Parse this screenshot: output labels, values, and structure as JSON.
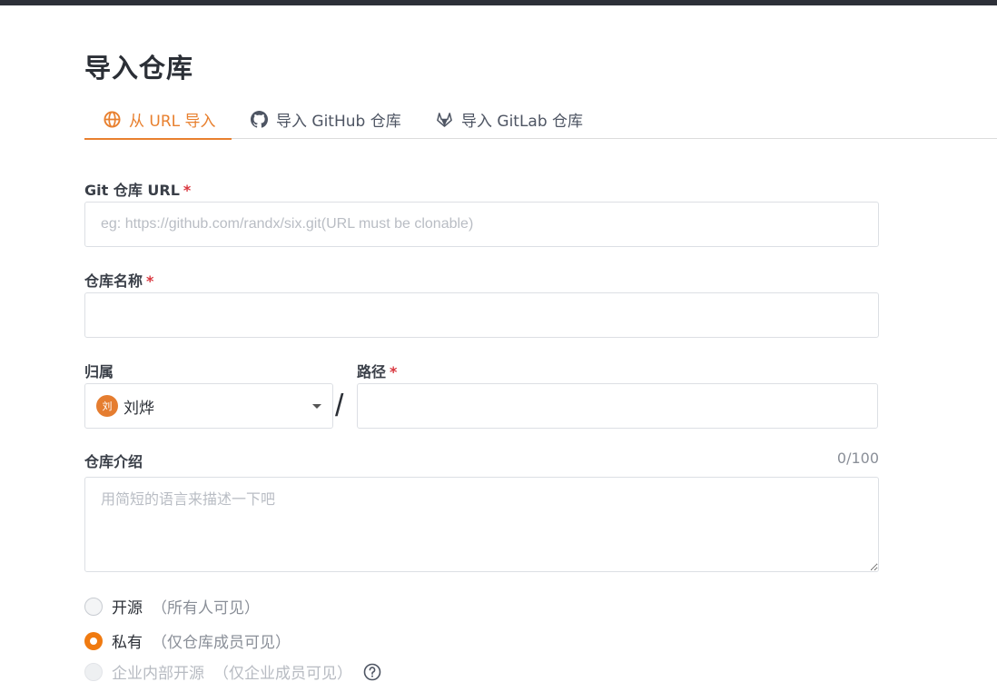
{
  "page": {
    "title": "导入仓库"
  },
  "tabs": [
    {
      "label": "从 URL 导入",
      "icon": "globe-icon",
      "active": true
    },
    {
      "label": "导入 GitHub 仓库",
      "icon": "github-icon",
      "active": false
    },
    {
      "label": "导入 GitLab 仓库",
      "icon": "gitlab-icon",
      "active": false
    }
  ],
  "form": {
    "git_url": {
      "label": "Git 仓库 URL",
      "required_mark": "*",
      "placeholder": "eg: https://github.com/randx/six.git(URL must be clonable)",
      "value": ""
    },
    "repo_name": {
      "label": "仓库名称",
      "required_mark": "*",
      "value": ""
    },
    "owner": {
      "label": "归属",
      "selected": "刘烨",
      "avatar_text": "刘"
    },
    "separator": "/",
    "path": {
      "label": "路径",
      "required_mark": "*",
      "value": ""
    },
    "description": {
      "label": "仓库介绍",
      "counter": "0/100",
      "placeholder": "用简短的语言来描述一下吧",
      "value": ""
    },
    "visibility": [
      {
        "label": "开源",
        "desc": "（所有人可见）",
        "state": "unchecked"
      },
      {
        "label": "私有",
        "desc": "（仅仓库成员可见）",
        "state": "checked"
      },
      {
        "label": "企业内部开源",
        "desc": "（仅企业成员可见）",
        "state": "disabled",
        "help_icon": "question-circle-icon"
      }
    ]
  },
  "colors": {
    "accent": "#e8802f",
    "radio_checked": "#f07a10",
    "required": "#d9363e",
    "topbar": "#2d3038"
  }
}
